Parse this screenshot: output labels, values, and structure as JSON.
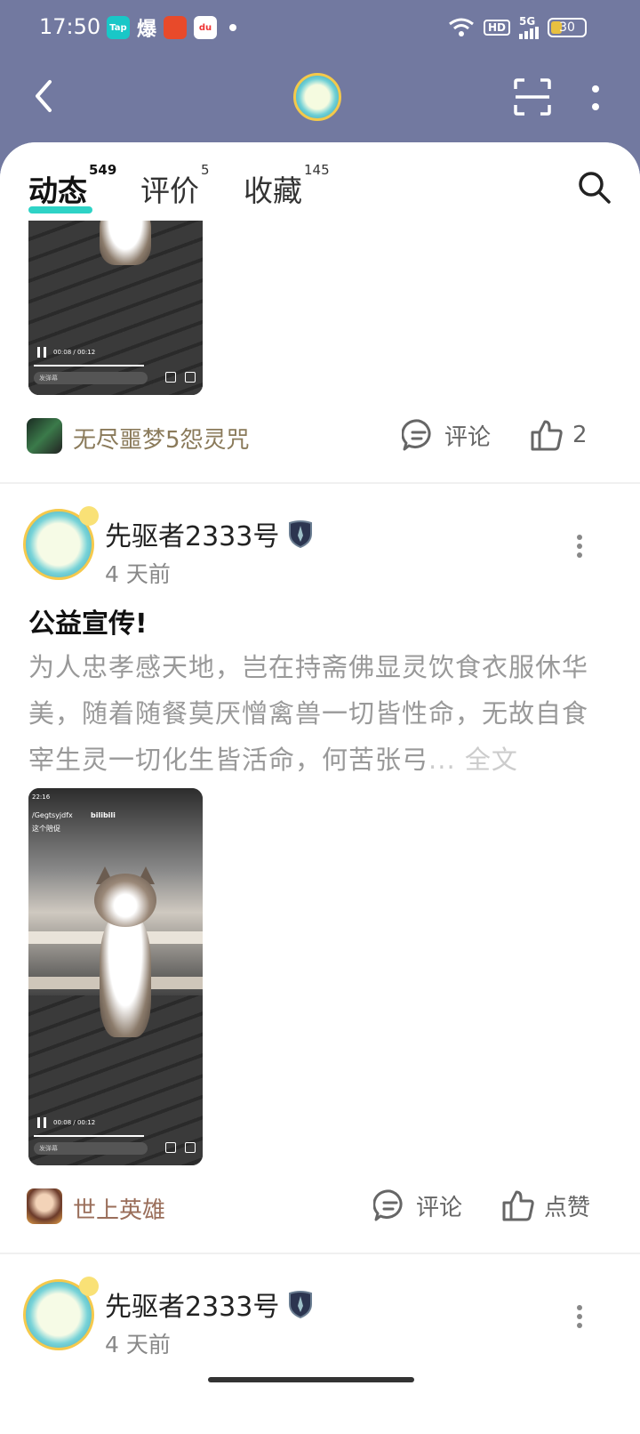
{
  "status_bar": {
    "time": "17:50",
    "apps": [
      "Tap",
      "爆",
      "",
      "du"
    ],
    "hd": "HD",
    "network": "5G",
    "battery": "30"
  },
  "tabs": [
    {
      "label": "动态",
      "count": "549"
    },
    {
      "label": "评价",
      "count": "5"
    },
    {
      "label": "收藏",
      "count": "145"
    }
  ],
  "posts": [
    {
      "video": {
        "timecode": "00:08 / 00:12",
        "danmu_placeholder": "发弹幕",
        "overlay": ""
      },
      "game_tag": "无尽噩梦5怨灵咒",
      "comment_label": "评论",
      "like_label": "2"
    },
    {
      "username": "先驱者2333号",
      "time_ago": "4 天前",
      "title": "公益宣传!",
      "body": "为人忠孝感天地，岂在持斋佛显灵饮食衣服休华美，随着随餐莫厌憎禽兽一切皆性命，无故自食宰生灵一切化生皆活命，何苦张弓",
      "more": "... 全文",
      "video": {
        "timecode": "00:08 / 00:12",
        "danmu_placeholder": "发弹幕",
        "clock": "22:16",
        "overlay_line1": "/Gegtsyjdfx",
        "overlay_line2": "这个陪促",
        "overlay_logo": "bilibili"
      },
      "game_tag": "世上英雄",
      "comment_label": "评论",
      "like_label": "点赞"
    },
    {
      "username": "先驱者2333号",
      "time_ago": "4 天前"
    }
  ],
  "colors": {
    "header_bg": "#7279a0",
    "tab_accent": "#2ed3c6",
    "tag_text": "#8a7a5a"
  }
}
